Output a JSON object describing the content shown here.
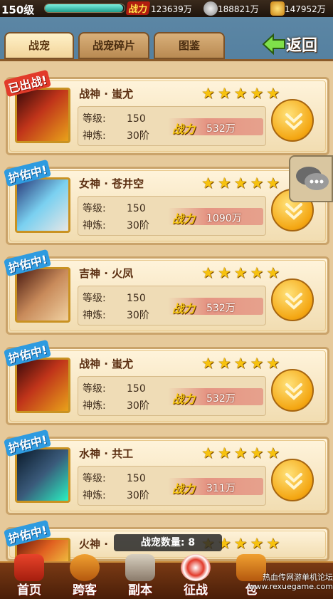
{
  "topbar": {
    "level": "150级",
    "exp_fraction": 0.98,
    "power_label": "战力",
    "power": "123639万",
    "silver": "188821万",
    "gold": "147952万"
  },
  "tabs": [
    {
      "label": "战宠"
    },
    {
      "label": "战宠碎片"
    },
    {
      "label": "图鉴"
    }
  ],
  "back_label": "返回",
  "pets": [
    {
      "badge": "已出战!",
      "badge_color": "#e23a2a",
      "name": "战神 · 蚩尤",
      "stars": "★★★★★",
      "level_label": "等级:",
      "level": "150",
      "refine_label": "神炼:",
      "refine": "30阶",
      "power_label": "战力",
      "power": "532万"
    },
    {
      "badge": "护佑中!",
      "badge_color": "#2e9be0",
      "name": "女神 · 苍井空",
      "stars": "★★★★★",
      "level_label": "等级:",
      "level": "150",
      "refine_label": "神炼:",
      "refine": "30阶",
      "power_label": "战力",
      "power": "1090万"
    },
    {
      "badge": "护佑中!",
      "badge_color": "#2e9be0",
      "name": "吉神 · 火凤",
      "stars": "★★★★★",
      "level_label": "等级:",
      "level": "150",
      "refine_label": "神炼:",
      "refine": "30阶",
      "power_label": "战力",
      "power": "532万"
    },
    {
      "badge": "护佑中!",
      "badge_color": "#2e9be0",
      "name": "战神 · 蚩尤",
      "stars": "★★★★★",
      "level_label": "等级:",
      "level": "150",
      "refine_label": "神炼:",
      "refine": "30阶",
      "power_label": "战力",
      "power": "532万"
    },
    {
      "badge": "护佑中!",
      "badge_color": "#2e9be0",
      "name": "水神 · 共工",
      "stars": "★★★★★",
      "level_label": "等级:",
      "level": "150",
      "refine_label": "神炼:",
      "refine": "30阶",
      "power_label": "战力",
      "power": "311万"
    },
    {
      "badge": "护佑中!",
      "badge_color": "#2e9be0",
      "name": "火神 ·",
      "stars": "★★★★★"
    }
  ],
  "pet_count": "战宠数量: 8",
  "bottomnav": [
    {
      "label": "首页"
    },
    {
      "label": "跨客"
    },
    {
      "label": "副本"
    },
    {
      "label": "征战"
    },
    {
      "label": "包"
    }
  ],
  "watermark": {
    "line1": "热血传网游单机论坛",
    "line2": "www.rexuegame.com"
  },
  "colors": {
    "accent_gold": "#f7c20f",
    "panel": "#e6c99a",
    "badge_blue": "#2e9be0",
    "badge_red": "#e23a2a"
  }
}
